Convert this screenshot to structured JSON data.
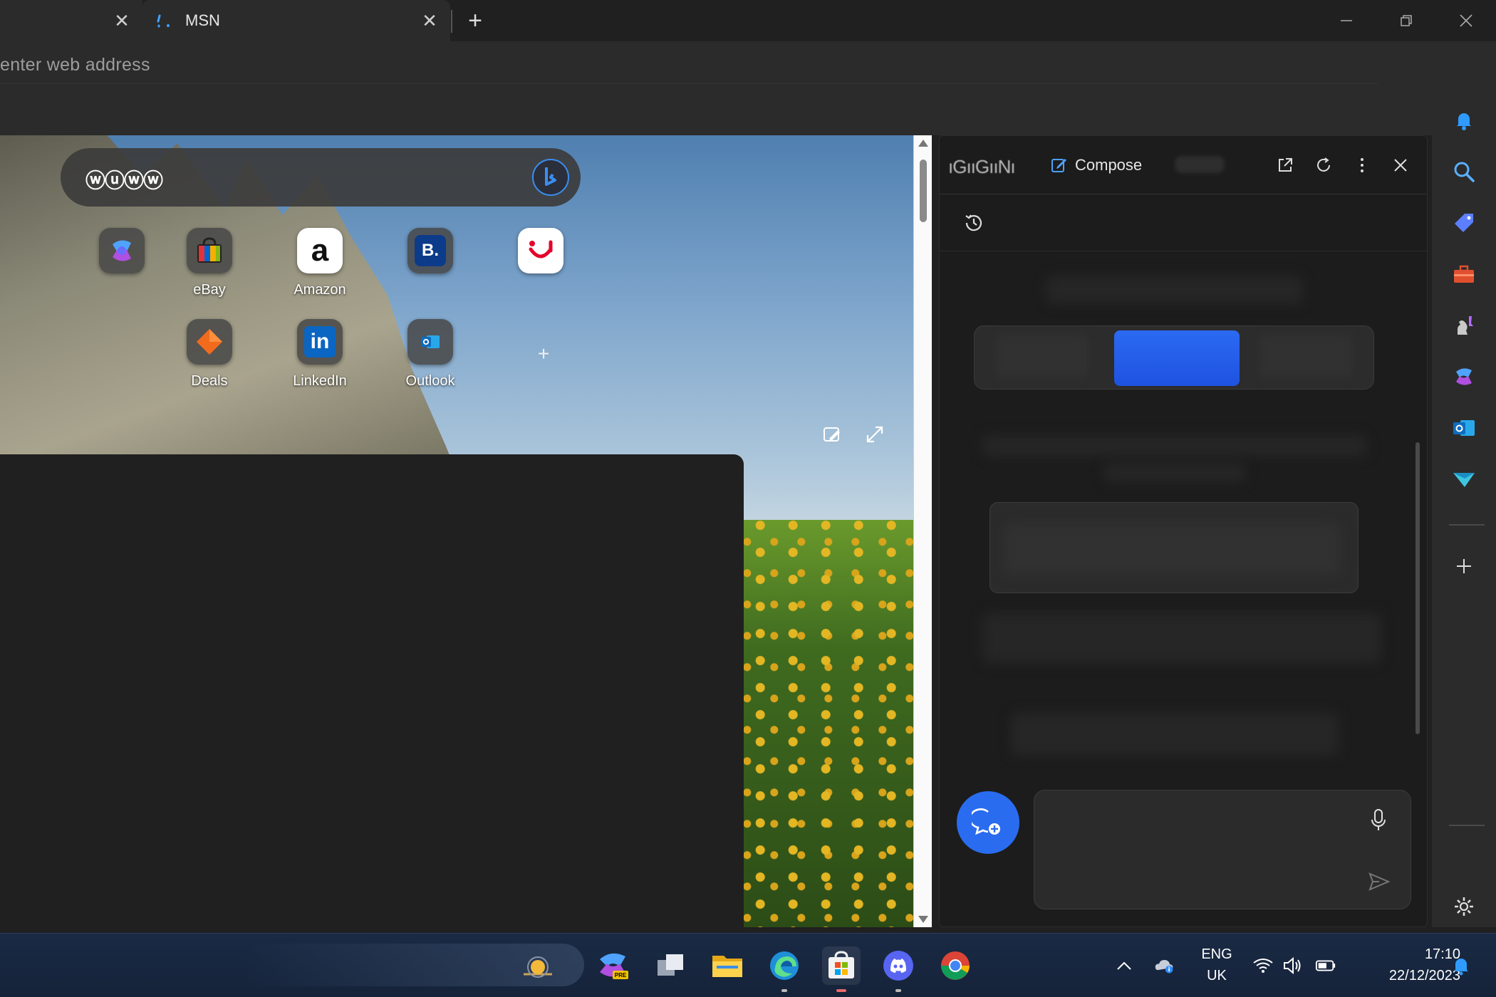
{
  "browser": {
    "tabs": [
      {
        "title": ""
      },
      {
        "title": "MSN",
        "active": true
      }
    ],
    "address_placeholder": "enter web address"
  },
  "newtab": {
    "search_logo": "ⓦⓤⓦⓦ",
    "shortcuts": [
      {
        "label": "",
        "icon": "copilot-icon"
      },
      {
        "label": "eBay",
        "icon": "ebay-bag-icon"
      },
      {
        "label": "Amazon",
        "icon": "amazon-icon"
      },
      {
        "label": "",
        "icon": "booking-icon"
      },
      {
        "label": "",
        "icon": "tui-icon"
      },
      {
        "label": "Deals",
        "icon": "deals-icon"
      },
      {
        "label": "LinkedIn",
        "icon": "linkedin-icon"
      },
      {
        "label": "Outlook",
        "icon": "outlook-icon"
      }
    ],
    "booking_letter": "B.",
    "amazon_letter": "a",
    "linkedin_letter": "in"
  },
  "copilot": {
    "title": "ıGııGııNı",
    "compose_label": "Compose",
    "accent": "#2b6af2"
  },
  "taskbar": {
    "language": "ENG",
    "region": "UK",
    "time": "17:10",
    "date": "22/12/2023"
  },
  "colors": {
    "bing_blue": "#3b8ef0",
    "chrome": "#2b2b2b",
    "taskbar": "#17263e"
  }
}
